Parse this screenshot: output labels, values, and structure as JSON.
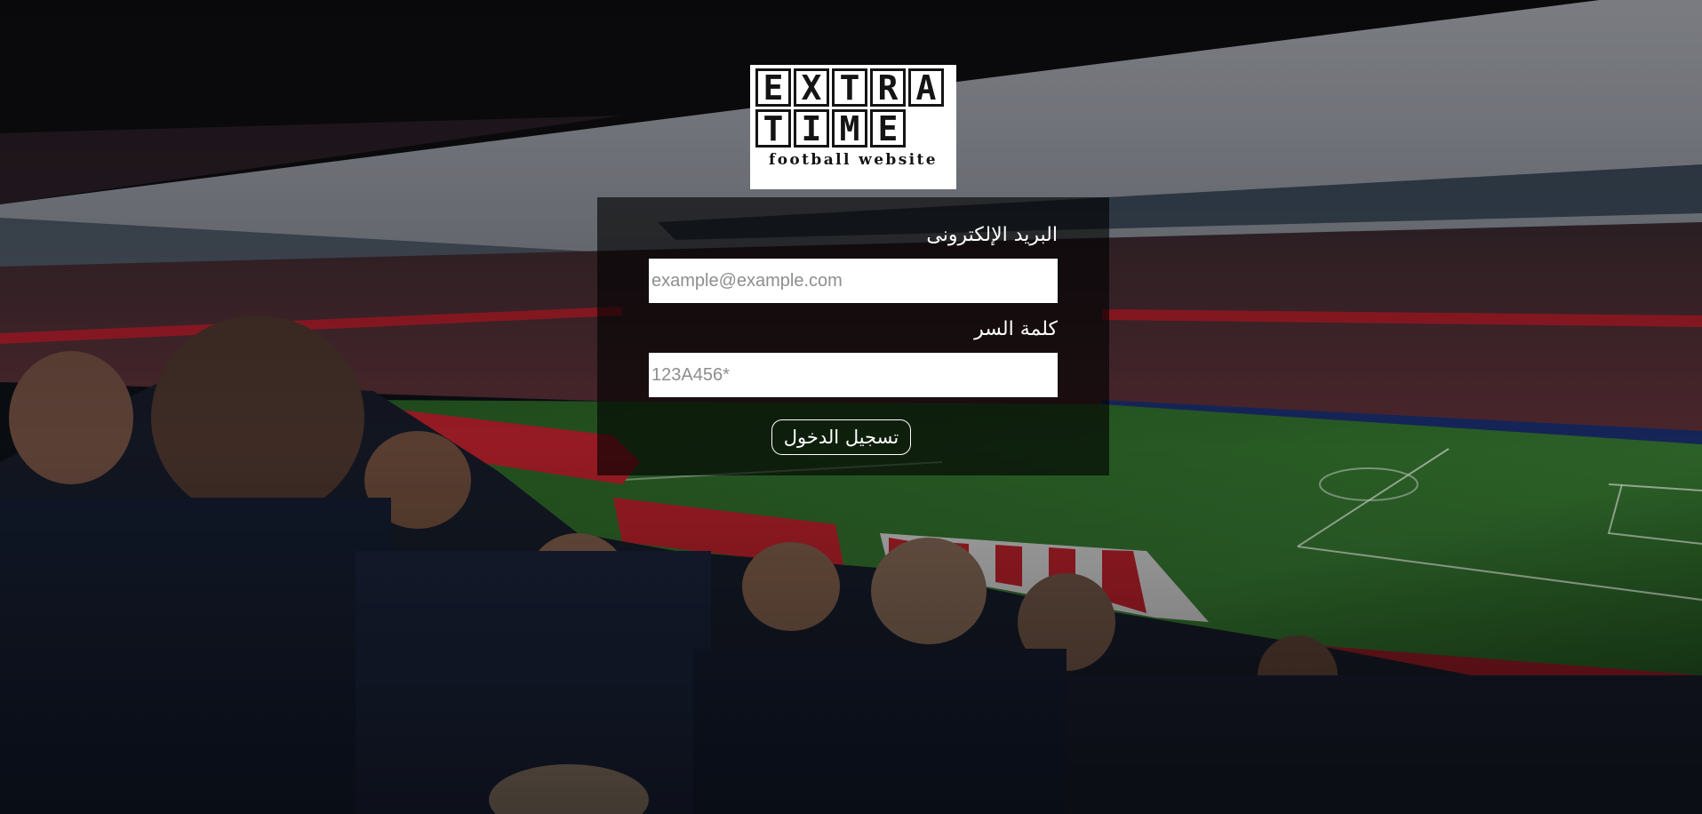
{
  "logo": {
    "row1": [
      "E",
      "X",
      "T",
      "R",
      "A"
    ],
    "row2": [
      "T",
      "I",
      "M",
      "E"
    ],
    "subtitle": "football website"
  },
  "login_form": {
    "email_label": "البريد الإلكترونى",
    "email_placeholder": "example@example.com",
    "password_label": "كلمة السر",
    "password_placeholder": "123A456*",
    "submit_label": "تسجيل الدخول"
  },
  "colors": {
    "panel_overlay": "rgba(0,0,0,0.62)",
    "text": "#ffffff",
    "pitch_green": "#2f6a2c",
    "crowd_red": "#b3202a"
  }
}
